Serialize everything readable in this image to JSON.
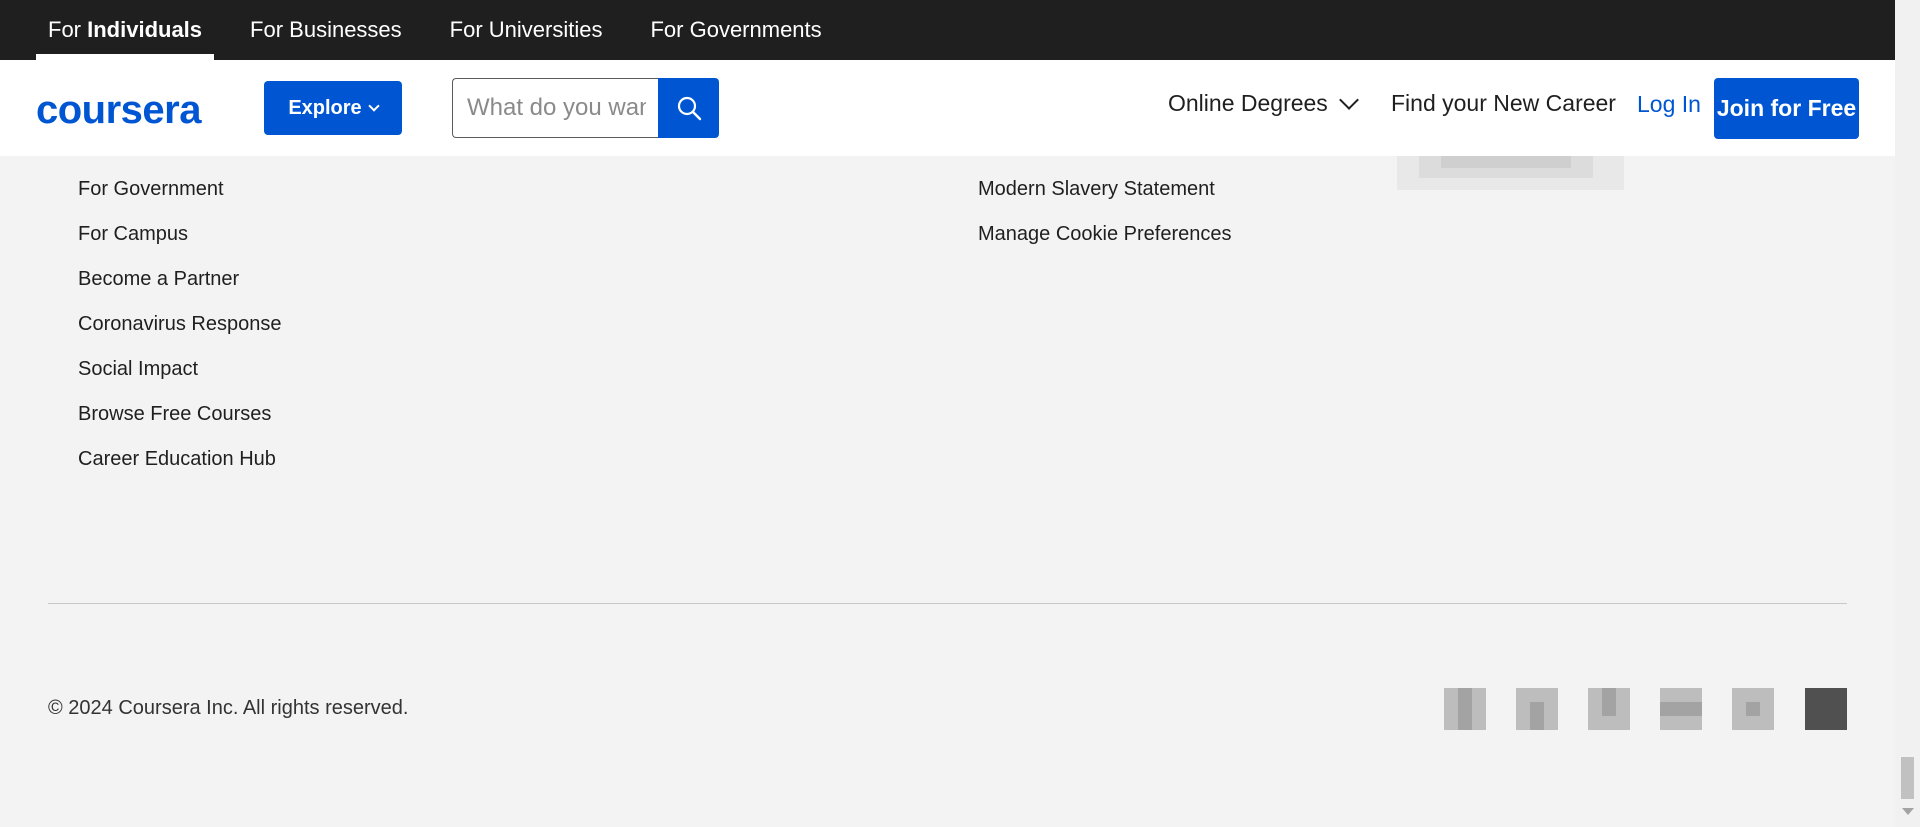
{
  "audience_nav": {
    "individuals_prefix": "For ",
    "individuals_bold": "Individuals",
    "businesses": "For Businesses",
    "universities": "For Universities",
    "governments": "For Governments"
  },
  "header": {
    "logo": "coursera",
    "explore_label": "Explore",
    "search_placeholder": "What do you want to learn?",
    "online_degrees": "Online Degrees",
    "find_career": "Find your New Career",
    "login": "Log In",
    "join": "Join for Free"
  },
  "footer": {
    "left_links": [
      "For Government",
      "For Campus",
      "Become a Partner",
      "Coronavirus Response",
      "Social Impact",
      "Browse Free Courses",
      "Career Education Hub"
    ],
    "middle_links": [
      "Modern Slavery Statement",
      "Manage Cookie Preferences"
    ],
    "copyright": "© 2024 Coursera Inc. All rights reserved.",
    "social_icons": [
      "facebook-icon",
      "linkedin-icon",
      "twitter-icon",
      "youtube-icon",
      "instagram-icon",
      "tiktok-icon"
    ]
  },
  "colors": {
    "brand_blue": "#0056d2",
    "top_bar": "#1f1f1f",
    "footer_bg": "#f3f3f3"
  }
}
